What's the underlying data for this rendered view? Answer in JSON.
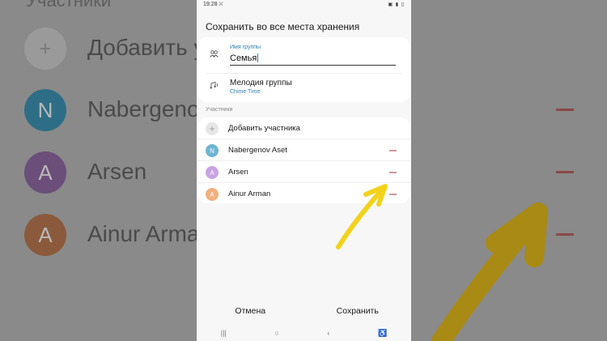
{
  "background": {
    "title": "Участники",
    "rows": [
      {
        "initial": "",
        "text": "Добавить у",
        "color": "#9a9a9a",
        "glyph": "+"
      },
      {
        "initial": "N",
        "text": "Nabergenov",
        "color": "#2d6e86"
      },
      {
        "initial": "A",
        "text": "Arsen",
        "color": "#6b4e7a"
      },
      {
        "initial": "A",
        "text": "Ainur Arma",
        "color": "#8b5a3c"
      }
    ]
  },
  "status_bar": {
    "time": "19:28",
    "extra": "⛌",
    "icons": "▣ ▮ ▯"
  },
  "dialog": {
    "title": "Сохранить во все места хранения",
    "group_name": {
      "label": "Имя группы",
      "value": "Семья"
    },
    "melody": {
      "title": "Мелодия группы",
      "value": "Chime Time"
    },
    "members_label": "Участники",
    "add_member": "Добавить участника",
    "members": [
      {
        "initial": "N",
        "name": "Nabergenov Aset",
        "color": "#6fb3d2"
      },
      {
        "initial": "A",
        "name": "Arsen",
        "color": "#c8a3e3"
      },
      {
        "initial": "A",
        "name": "Ainur Arman",
        "color": "#f2b07c"
      }
    ],
    "cancel": "Отмена",
    "save": "Сохранить"
  },
  "nav": {
    "recent": "|||",
    "home": "○",
    "back": "‹",
    "accessibility": "♿"
  },
  "accent": "#2f7fb0"
}
